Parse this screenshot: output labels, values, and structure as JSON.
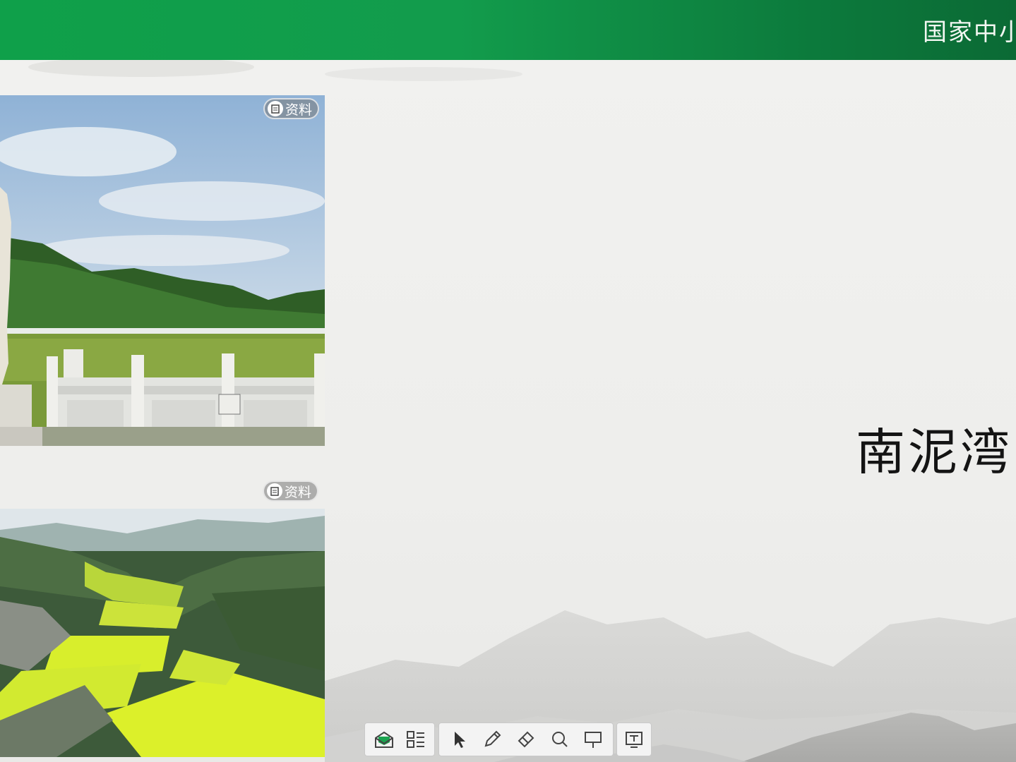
{
  "header": {
    "title": "国家中小学智慧教育平台"
  },
  "slide": {
    "title": "南泥湾",
    "photos": [
      {
        "badge_label": "资料",
        "description_icon": "document-icon"
      },
      {
        "badge_label": "资料",
        "description_icon": "document-icon"
      }
    ]
  },
  "toolbar": {
    "groups": [
      [
        "envelope-icon",
        "layout-grid-icon"
      ],
      [
        "pointer-icon",
        "pen-icon",
        "eraser-icon",
        "search-icon",
        "whiteboard-icon"
      ],
      [
        "presentation-icon"
      ]
    ]
  },
  "colors": {
    "header_green": "#0fa04a",
    "header_dark_green": "#0b6a35",
    "accent_green": "#1aa34f"
  }
}
